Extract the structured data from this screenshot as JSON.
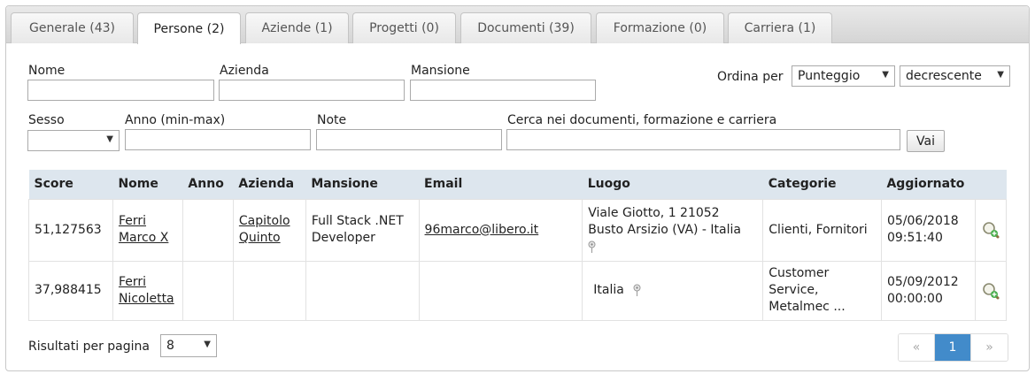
{
  "tabs": [
    {
      "label": "Generale (43)"
    },
    {
      "label": "Persone (2)"
    },
    {
      "label": "Aziende (1)"
    },
    {
      "label": "Progetti (0)"
    },
    {
      "label": "Documenti (39)"
    },
    {
      "label": "Formazione (0)"
    },
    {
      "label": "Carriera (1)"
    }
  ],
  "active_tab": "Persone (2)",
  "filters": {
    "nome_label": "Nome",
    "azienda_label": "Azienda",
    "mansione_label": "Mansione",
    "ordina_label": "Ordina per",
    "ordina_value": "Punteggio",
    "direction_value": "decrescente",
    "sesso_label": "Sesso",
    "sesso_value": "",
    "anno_label": "Anno (min-max)",
    "note_label": "Note",
    "cerca_label": "Cerca nei documenti, formazione e carriera",
    "vai_label": "Vai"
  },
  "table": {
    "headers": [
      "Score",
      "Nome",
      "Anno",
      "Azienda",
      "Mansione",
      "Email",
      "Luogo",
      "Categorie",
      "Aggiornato"
    ],
    "rows": [
      {
        "score": "51,127563",
        "nome_1": "Ferri",
        "nome_2": "Marco X",
        "anno": "",
        "azienda_1": "Capitolo",
        "azienda_2": "Quinto",
        "mansione_1": "Full Stack .NET",
        "mansione_2": "Developer",
        "email": "96marco@libero.it",
        "luogo_1": "Viale Giotto, 1 21052",
        "luogo_2": "Busto Arsizio (VA) - Italia",
        "categorie": "Clienti, Fornitori",
        "aggiornato_1": "05/06/2018",
        "aggiornato_2": "09:51:40"
      },
      {
        "score": "37,988415",
        "nome_1": "Ferri",
        "nome_2": "Nicoletta",
        "anno": "",
        "azienda": "",
        "mansione": "",
        "email": "",
        "luogo": "Italia",
        "categorie_1": "Customer",
        "categorie_2": "Service,",
        "categorie_3": "Metalmec ...",
        "aggiornato_1": "05/09/2012",
        "aggiornato_2": "00:00:00"
      }
    ]
  },
  "footer": {
    "per_page_label": "Risultati per pagina",
    "per_page_value": "8",
    "pager_prev": "«",
    "pager_current": "1",
    "pager_next": "»"
  },
  "colors": {
    "header_bg": "#dde6ee",
    "pager_active": "#428bca"
  }
}
